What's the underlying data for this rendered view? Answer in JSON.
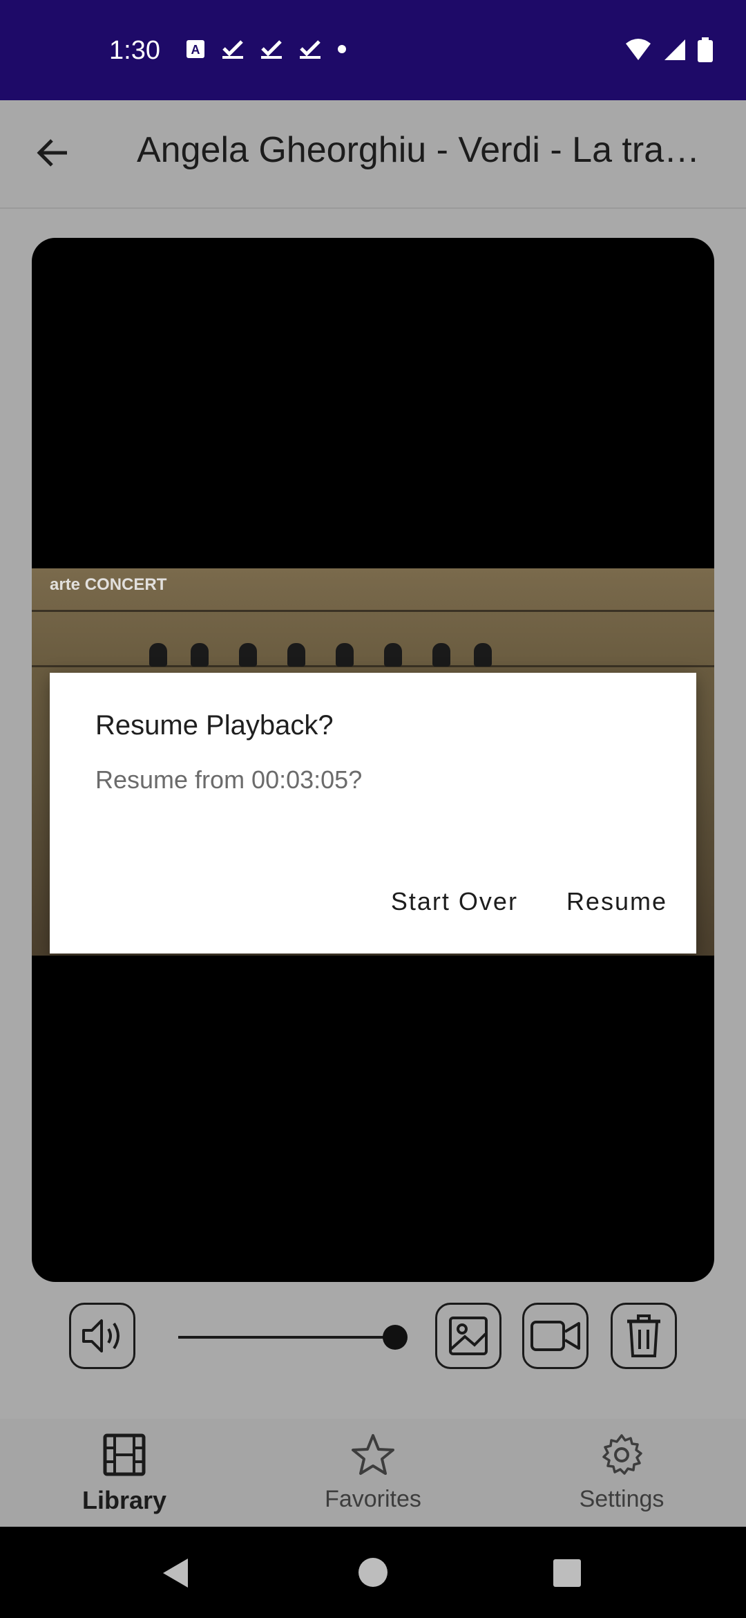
{
  "status_bar": {
    "time": "1:30"
  },
  "app_bar": {
    "title": "Angela Gheorghiu - Verdi - La traviata"
  },
  "video": {
    "watermark": "arte CONCERT"
  },
  "dialog": {
    "title": "Resume Playback?",
    "message": "Resume from 00:03:05?",
    "start_over_label": "Start Over",
    "resume_label": "Resume"
  },
  "controls": {
    "volume_level": 1.0,
    "icons": [
      "volume-icon",
      "image-icon",
      "video-camera-icon",
      "trash-icon"
    ]
  },
  "bottom_nav": {
    "items": [
      {
        "label": "Library",
        "icon": "film-icon",
        "active": true
      },
      {
        "label": "Favorites",
        "icon": "star-icon",
        "active": false
      },
      {
        "label": "Settings",
        "icon": "gear-icon",
        "active": false
      }
    ]
  },
  "colors": {
    "status_bar": "#1e0a68",
    "scrim_background": "#a9a9a9"
  }
}
